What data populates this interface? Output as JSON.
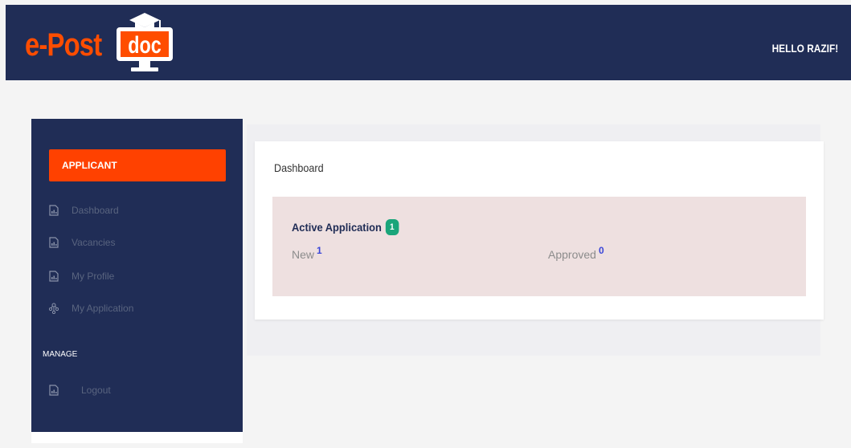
{
  "header": {
    "logo": {
      "prefix": "e-Post",
      "suffix": "doc"
    },
    "greeting": "HELLO RAZIF!"
  },
  "sidebar": {
    "role_label": "APPLICANT",
    "items": [
      {
        "label": "Dashboard",
        "icon": "document-icon"
      },
      {
        "label": "Vacancies",
        "icon": "document-icon"
      },
      {
        "label": "My Profile",
        "icon": "document-icon"
      },
      {
        "label": "My Application",
        "icon": "network-icon"
      }
    ],
    "section_manage": "MANAGE",
    "manage_items": [
      {
        "label": "Logout",
        "icon": "document-icon"
      }
    ]
  },
  "main": {
    "title": "Dashboard",
    "active_application": {
      "title": "Active Application",
      "count": "1",
      "new_label": "New",
      "new_count": "1",
      "approved_label": "Approved",
      "approved_count": "0"
    }
  },
  "colors": {
    "navy": "#202d56",
    "accent": "#ff4100",
    "badge": "#1aa57a",
    "panel": "#eee0e0"
  }
}
